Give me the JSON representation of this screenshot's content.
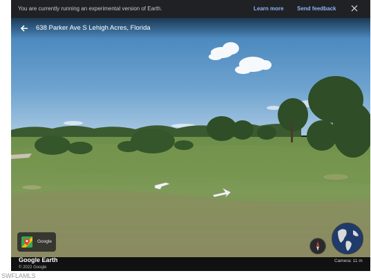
{
  "banner": {
    "message": "You are currently running an experimental version of Earth.",
    "learn_more": "Learn more",
    "send_feedback": "Send feedback",
    "close_icon": "close-icon"
  },
  "header": {
    "back_icon": "arrow-back-icon",
    "address": "638 Parker Ave S Lehigh Acres, Florida"
  },
  "streetview": {
    "nav_arrows": [
      "chevron-left-arrow",
      "chevron-right-arrow"
    ]
  },
  "pegman_card": {
    "label": "Google",
    "icon": "google-maps-icon"
  },
  "footer": {
    "logo": "Google Earth",
    "copyright": "© 2022 Google",
    "camera": "Camera: 11 m"
  },
  "watermark": "SWFLAMLS"
}
